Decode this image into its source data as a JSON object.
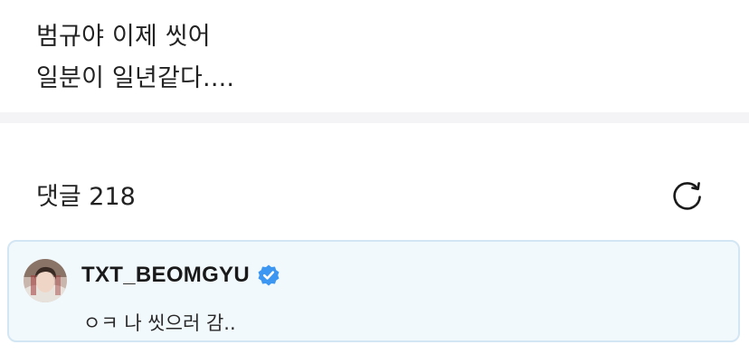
{
  "post": {
    "lines": [
      "범규야 이제 씻어",
      "일분이 일년같다...."
    ]
  },
  "comments": {
    "header": "댓글 218",
    "refresh_icon": "refresh-icon"
  },
  "comment": {
    "author": "TXT_BEOMGYU",
    "verified": true,
    "verified_color": "#3b97f2",
    "text": "ㅇㅋ 나 씻으러 감..",
    "highlight_background": "#f2f9fd",
    "highlight_border": "#d3e6f3"
  }
}
